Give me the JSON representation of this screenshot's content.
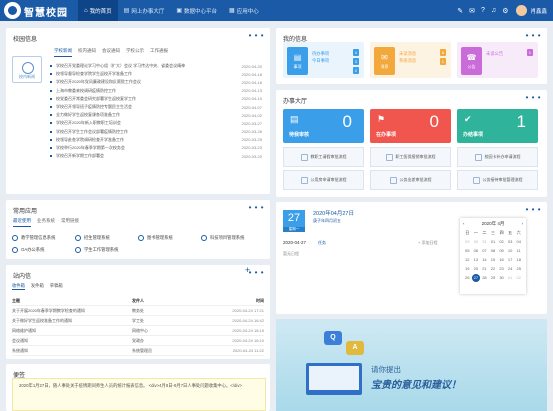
{
  "header": {
    "app_title": "智慧校园",
    "nav": [
      {
        "label": "我的首页",
        "icon": "home-icon",
        "active": true
      },
      {
        "label": "网上办事大厅",
        "icon": "hall-icon"
      },
      {
        "label": "数据中心平台",
        "icon": "data-icon"
      },
      {
        "label": "应用中心",
        "icon": "apps-icon"
      }
    ],
    "user_name": "肖鑫鑫"
  },
  "campus_info": {
    "title": "校园信息",
    "more": "• • •",
    "tabs": [
      "学校新闻",
      "校内通知",
      "会议通知",
      "学校公示",
      "工作通报"
    ],
    "icon_label": "校内新闻",
    "news": [
      {
        "title": "学校召开党委理论学习中心组（扩大）会议 学习传达中央、省委会议精神",
        "date": "2020-04-20"
      },
      {
        "title": "校领导督导检查学院学生返校开学准备工作",
        "date": "2020-04-18"
      },
      {
        "title": "学校召开2020年党风廉政建设和反腐败工作会议",
        "date": "2020-04-16"
      },
      {
        "title": "上海市教委来校调研疫情防控工作",
        "date": "2020-04-13"
      },
      {
        "title": "校党委召开常委会研究部署学生返校复学工作",
        "date": "2020-04-10"
      },
      {
        "title": "学校召开领导班子疫情防控专题民主生活会",
        "date": "2020-04-07"
      },
      {
        "title": "全力做好学生返校复课各项准备工作",
        "date": "2020-04-02"
      },
      {
        "title": "学校召开2020年新入职教职工培训会",
        "date": "2020-03-27"
      },
      {
        "title": "学校召开学生工作会议部署疫情防控工作",
        "date": "2020-03-26"
      },
      {
        "title": "校领导赴各学院调研检查开学准备工作",
        "date": "2020-03-25"
      },
      {
        "title": "学校举行2020年春季学期第一次校务会",
        "date": "2020-03-23"
      },
      {
        "title": "学校召开新学期工作部署会",
        "date": "2020-03-20"
      }
    ]
  },
  "common_apps": {
    "title": "常用应用",
    "more": "• • •",
    "tabs": [
      "最近使用",
      "业务系统",
      "常用链接"
    ],
    "items": [
      "教学管理信息系统",
      "招生管理系统",
      "图书管理系统",
      "科技项目管理系统",
      "OA办公系统",
      "学生工作管理系统"
    ]
  },
  "mail": {
    "title": "站内信",
    "more": "• • •",
    "plus": "+",
    "toolbar": [
      "收件箱",
      "发件箱",
      "草稿箱"
    ],
    "columns": [
      "主题",
      "发件人",
      "时间"
    ],
    "rows": [
      {
        "subject": "关于开展2020年春季学期教学检查的通知",
        "sender": "教务处",
        "time": "2020-04-24 17:21"
      },
      {
        "subject": "关于做好学生返校准备工作的通知",
        "sender": "学工处",
        "time": "2020-04-24 16:42"
      },
      {
        "subject": "网络维护通知",
        "sender": "网络中心",
        "time": "2020-04-24 16:15"
      },
      {
        "subject": "会议通知",
        "sender": "党政办",
        "time": "2020-04-24 16:10"
      },
      {
        "subject": "系统通知",
        "sender": "系统管理员",
        "time": "2020-04-24 11:22"
      }
    ]
  },
  "notes": {
    "title": "便签",
    "text": "2020年1月27日，随人事处关于疫情期间师生人员的统计报表信息。 <div>4月8日-9月7日人事处问题收集中心。</div>"
  },
  "my_info": {
    "title": "我的信息",
    "more": "• • •",
    "cards": [
      {
        "icon_label": "事项",
        "color": "#3a9ee8",
        "lines": [
          "待办事项",
          "今日事项"
        ],
        "tags": [
          "4",
          "3",
          "2"
        ],
        "tag_color": "#3a9ee8"
      },
      {
        "icon_label": "消息",
        "color": "#f2a83b",
        "lines": [
          "未读消息",
          "系统消息"
        ],
        "tags": [
          "6",
          "1"
        ],
        "tag_color": "#f2a83b"
      },
      {
        "icon_label": "公告",
        "color": "#c96bd8",
        "lines": [
          "未读公告"
        ],
        "tags": [
          "1"
        ],
        "tag_color": "#c96bd8"
      }
    ]
  },
  "service_hall": {
    "title": "办事大厅",
    "more": "• • •",
    "stats": [
      {
        "label": "待我审核",
        "value": "0",
        "color": "#3a9ee8",
        "icon": "clipboard-icon"
      },
      {
        "label": "在办事项",
        "value": "0",
        "color": "#f0554e",
        "icon": "flag-icon"
      },
      {
        "label": "办结事项",
        "value": "1",
        "color": "#2fb39a",
        "icon": "check-icon"
      }
    ],
    "services": [
      "教职工请假审批流程",
      "职工医保报销审批流程",
      "校园卡补办申请流程",
      "公用房申请审批流程",
      "公务出差审批流程",
      "公务接待审批管理流程"
    ]
  },
  "schedule": {
    "more": "• • •",
    "day": "27",
    "weekday": "星期一",
    "full_date": "2020年04月27日",
    "sub": "庚子年四月初五",
    "date_line": "2020-04-27",
    "badge": "任务",
    "add": "+ 添加日程",
    "empty": "暂无日程"
  },
  "calendar": {
    "month_label": "2020年 4月",
    "prev": "‹",
    "next": "›",
    "weekdays": [
      "日",
      "一",
      "二",
      "三",
      "四",
      "五",
      "六"
    ],
    "days": [
      "29",
      "30",
      "31",
      "01",
      "02",
      "03",
      "04",
      "05",
      "06",
      "07",
      "08",
      "09",
      "10",
      "11",
      "12",
      "13",
      "14",
      "15",
      "16",
      "17",
      "18",
      "19",
      "20",
      "21",
      "22",
      "23",
      "24",
      "25",
      "26",
      "27",
      "28",
      "29",
      "30",
      "01",
      "02"
    ],
    "today": "27"
  },
  "feedback": {
    "q": "Q",
    "a": "A",
    "line1": "请你提出",
    "line2": "宝贵的意见和建议！"
  },
  "colors": {
    "brand": "#1a5aa6",
    "accent": "#3a9ee8"
  }
}
